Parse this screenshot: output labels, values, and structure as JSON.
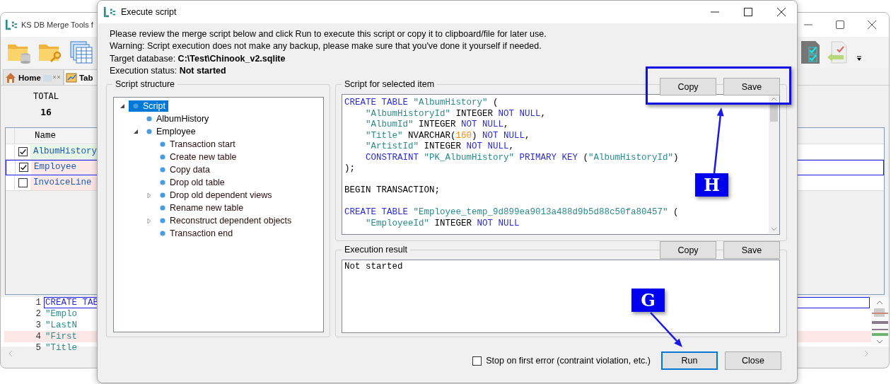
{
  "app_window": {
    "title": "KS DB Merge Tools f",
    "tabs": [
      {
        "label": "Home",
        "selected": false
      },
      {
        "label": "Tab",
        "selected": true
      }
    ],
    "summary": {
      "label": "TOTAL",
      "value": "16"
    },
    "table": {
      "columns": [
        "Name"
      ],
      "rows": [
        {
          "checked": true,
          "name": "AlbumHistory",
          "color": "#e6f5e6",
          "selected": false
        },
        {
          "checked": true,
          "name": "Employee",
          "color": "#fde8e8",
          "selected": true
        },
        {
          "checked": false,
          "name": "InvoiceLine",
          "color": "#fde8e8",
          "selected": false
        }
      ]
    },
    "code_preview": {
      "lines": [
        {
          "number": "1",
          "text": "CREATE TAB",
          "kind": "keyword",
          "selected": true,
          "changed": false
        },
        {
          "number": "2",
          "text": "\"Emplo",
          "kind": "string",
          "selected": false,
          "changed": false
        },
        {
          "number": "3",
          "text": "\"LastN",
          "kind": "string",
          "selected": false,
          "changed": false
        },
        {
          "number": "4",
          "text": "\"First",
          "kind": "string",
          "selected": false,
          "changed": true
        },
        {
          "number": "5",
          "text": "\"Title",
          "kind": "string",
          "selected": false,
          "changed": false
        }
      ]
    }
  },
  "dialog": {
    "title": "Execute script",
    "intro": [
      "Please review the merge script below and click Run to execute this script or copy it to clipboard/file for later use.",
      "Warning: Script execution does not make any backup, please make sure that you've done it yourself if needed.",
      "Target database: **C:\\Test\\Chinook_v2.sqlite**",
      "Execution status: **Not started**"
    ],
    "script_structure": {
      "title": "Script structure",
      "tree": [
        {
          "label": "Script",
          "selected": true,
          "expanded": true,
          "children": [
            {
              "label": "AlbumHistory",
              "selected": false
            },
            {
              "label": "Employee",
              "selected": false,
              "expanded": true,
              "children": [
                {
                  "label": "Transaction start",
                  "selected": false
                },
                {
                  "label": "Create new table",
                  "selected": false
                },
                {
                  "label": "Copy data",
                  "selected": false
                },
                {
                  "label": "Drop old table",
                  "selected": false
                },
                {
                  "label": "Drop old dependent views",
                  "selected": false,
                  "expanded": false
                },
                {
                  "label": "Rename new table",
                  "selected": false
                },
                {
                  "label": "Reconstruct dependent objects",
                  "selected": false,
                  "expanded": false
                },
                {
                  "label": "Transaction end",
                  "selected": false
                }
              ]
            }
          ]
        }
      ]
    },
    "script_panel": {
      "title": "Script for selected item",
      "buttons": [
        "Copy",
        "Save"
      ],
      "lines": [
        {
          "kind": "code",
          "indent": false,
          "tokens": [
            {
              "kind": "keyword",
              "text": "CREATE TABLE"
            },
            {
              "kind": "string",
              "text": " \"AlbumHistory\""
            },
            {
              "kind": "plain",
              "text": " ("
            }
          ]
        },
        {
          "kind": "code",
          "indent": true,
          "tokens": [
            {
              "kind": "string",
              "text": "\"AlbumHistoryId\""
            },
            {
              "kind": "plain",
              "text": " INTEGER "
            },
            {
              "kind": "keyword",
              "text": "NOT NULL"
            },
            {
              "kind": "plain",
              "text": ","
            }
          ]
        },
        {
          "kind": "code",
          "indent": true,
          "tokens": [
            {
              "kind": "string",
              "text": "\"AlbumId\""
            },
            {
              "kind": "plain",
              "text": " INTEGER "
            },
            {
              "kind": "keyword",
              "text": "NOT NULL"
            },
            {
              "kind": "plain",
              "text": ","
            }
          ]
        },
        {
          "kind": "code",
          "indent": true,
          "tokens": [
            {
              "kind": "string",
              "text": "\"Title\""
            },
            {
              "kind": "plain",
              "text": " NVARCHAR("
            },
            {
              "kind": "number",
              "text": "160"
            },
            {
              "kind": "plain",
              "text": ") "
            },
            {
              "kind": "keyword",
              "text": "NOT NULL"
            },
            {
              "kind": "plain",
              "text": ","
            }
          ]
        },
        {
          "kind": "code",
          "indent": true,
          "tokens": [
            {
              "kind": "string",
              "text": "\"ArtistId\""
            },
            {
              "kind": "plain",
              "text": " INTEGER "
            },
            {
              "kind": "keyword",
              "text": "NOT NULL"
            },
            {
              "kind": "plain",
              "text": ","
            }
          ]
        },
        {
          "kind": "code",
          "indent": true,
          "tokens": [
            {
              "kind": "keyword",
              "text": "CONSTRAINT"
            },
            {
              "kind": "string",
              "text": " \"PK_AlbumHistory\""
            },
            {
              "kind": "keyword",
              "text": " PRIMARY KEY"
            },
            {
              "kind": "plain",
              "text": " ("
            },
            {
              "kind": "string",
              "text": "\"AlbumHistoryId\""
            },
            {
              "kind": "plain",
              "text": ")"
            }
          ]
        },
        {
          "kind": "code",
          "indent": false,
          "tokens": [
            {
              "kind": "plain",
              "text": ");"
            }
          ]
        },
        {
          "kind": "blank"
        },
        {
          "kind": "code",
          "indent": false,
          "tokens": [
            {
              "kind": "plain",
              "text": "BEGIN TRANSACTION;"
            }
          ]
        },
        {
          "kind": "blank"
        },
        {
          "kind": "code",
          "indent": false,
          "tokens": [
            {
              "kind": "keyword",
              "text": "CREATE TABLE"
            },
            {
              "kind": "string",
              "text": " \"Employee_temp_9d899ea9013a488d9b5d88c50fa80457\""
            },
            {
              "kind": "plain",
              "text": " ("
            }
          ]
        },
        {
          "kind": "code",
          "indent": true,
          "tokens": [
            {
              "kind": "string",
              "text": "\"EmployeeId\""
            },
            {
              "kind": "plain",
              "text": " INTEGER "
            },
            {
              "kind": "keyword",
              "text": "NOT NULL"
            }
          ]
        }
      ]
    },
    "result_panel": {
      "title": "Execution result",
      "buttons": [
        "Copy",
        "Save"
      ],
      "text": "Not started"
    },
    "stop_on_error": {
      "label": "Stop on first error (contraint violation, etc.)",
      "checked": false
    },
    "buttons": [
      {
        "label": "Run",
        "focused": true
      },
      {
        "label": "Close",
        "focused": false
      }
    ]
  },
  "annotations": [
    {
      "label": "H",
      "kind": "highlight"
    },
    {
      "label": "G",
      "kind": "callout"
    }
  ]
}
